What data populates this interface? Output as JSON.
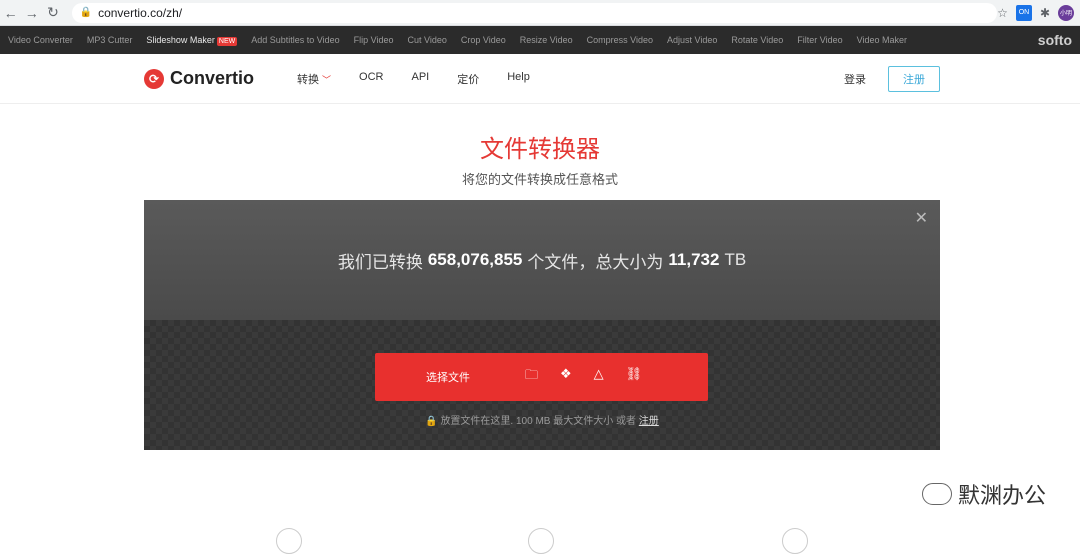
{
  "browser": {
    "url": "convertio.co/zh/",
    "avatar_text": "小明",
    "ext_text": "ON"
  },
  "softo_bar": {
    "items": [
      "Video Converter",
      "MP3 Cutter",
      "Slideshow Maker",
      "Add Subtitles to Video",
      "Flip Video",
      "Cut Video",
      "Crop Video",
      "Resize Video",
      "Compress Video",
      "Adjust Video",
      "Rotate Video",
      "Filter Video",
      "Video Maker"
    ],
    "new_badge": "NEW",
    "brand": "softo"
  },
  "header": {
    "logo": "Convertio",
    "menu": [
      "转换",
      "OCR",
      "API",
      "定价",
      "Help"
    ],
    "login": "登录",
    "signup": "注册"
  },
  "hero": {
    "title": "文件转换器",
    "subtitle": "将您的文件转换成任意格式"
  },
  "stats": {
    "prefix": "我们已转换",
    "files": "658,076,855",
    "middle": "个文件，总大小为",
    "size": "11,732",
    "unit": "TB"
  },
  "upload": {
    "choose_label": "选择文件",
    "note_prefix": "放置文件在这里. 100 MB 最大文件大小 或者",
    "note_link": "注册"
  },
  "watermark": "默渊办公",
  "colors": {
    "accent": "#e8302e",
    "signup": "#3aa8d8"
  }
}
